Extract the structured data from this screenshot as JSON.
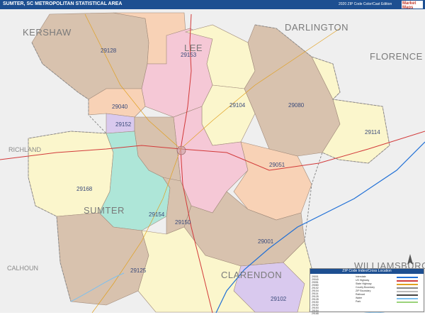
{
  "header": {
    "title": "SUMTER, SC METROPOLITAN STATISTICAL AREA",
    "edition": "2020 ZIP Code Color/Cast Edition",
    "brand": "Market Maps"
  },
  "map": {
    "counties": {
      "kershaw": "KERSHAW",
      "lee": "LEE",
      "darlington": "DARLINGTON",
      "florence": "FLORENCE",
      "richland": "RICHLAND",
      "sumter": "SUMTER",
      "calhoun": "CALHOUN",
      "clarendon": "CLARENDON",
      "williamsburg": "WILLIAMSBURG"
    },
    "zips": {
      "z29128": "29128",
      "z29153": "29153",
      "z29040": "29040",
      "z29152": "29152",
      "z29104": "29104",
      "z29080": "29080",
      "z29114": "29114",
      "z29051": "29051",
      "z29168": "29168",
      "z29154": "29154",
      "z29150": "29150",
      "z29001": "29001",
      "z29125": "29125",
      "z29102": "29102"
    },
    "colors": {
      "tan": "#d8c2ae",
      "pink": "#f5c8d6",
      "peach": "#f8d2b6",
      "yellow": "#fbf6cc",
      "teal": "#aee6d8",
      "lavender": "#d9c9ee",
      "background": "#efefef"
    }
  },
  "legend": {
    "title": "ZIP Code Index/Cross Location",
    "zip_list": [
      "29001",
      "29040",
      "29051",
      "29080",
      "29102",
      "29104",
      "29114",
      "29125",
      "29128",
      "29150",
      "29152",
      "29153",
      "29154",
      "29168"
    ],
    "key_items": [
      {
        "label": "Interstate",
        "color": "#1f6fd6"
      },
      {
        "label": "US Highway",
        "color": "#d23a3a"
      },
      {
        "label": "State Highway",
        "color": "#e0a020"
      },
      {
        "label": "County Boundary",
        "color": "#888888"
      },
      {
        "label": "ZIP Boundary",
        "color": "#bbbbbb"
      },
      {
        "label": "Railroad",
        "color": "#444444"
      },
      {
        "label": "Water",
        "color": "#7cc0ef"
      },
      {
        "label": "Park",
        "color": "#9bd37a"
      }
    ]
  }
}
